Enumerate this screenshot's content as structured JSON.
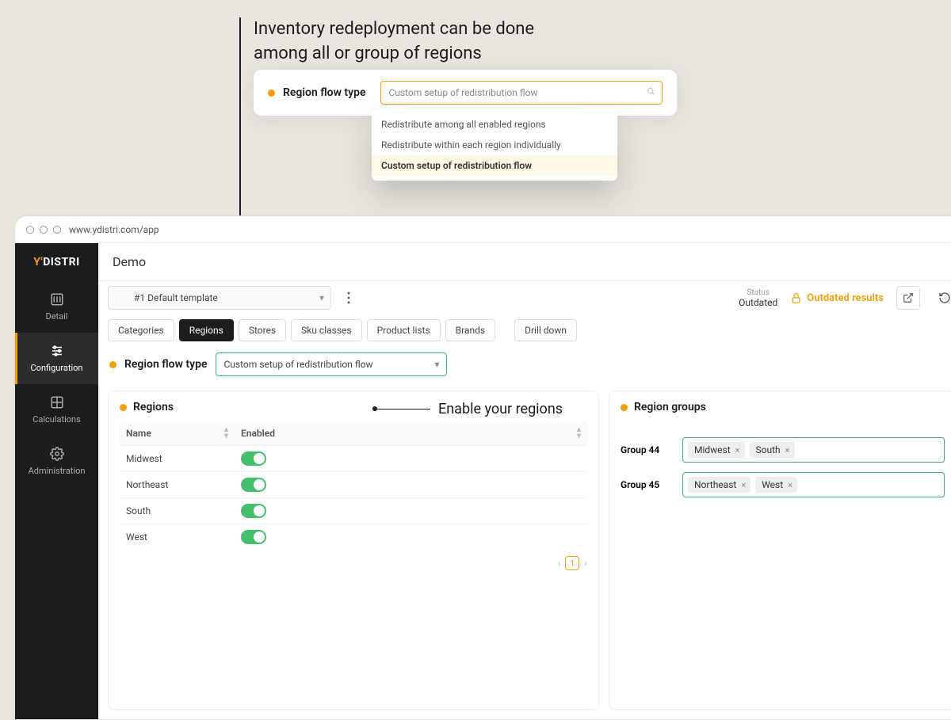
{
  "callout": {
    "line1": "Inventory redeployment can be done",
    "line2": "among all or group of regions"
  },
  "float": {
    "label": "Region flow type",
    "placeholder": "Custom setup of redistribution flow",
    "options": [
      "Redistribute among all enabled regions",
      "Redistribute within each region individually",
      "Custom setup of redistribution flow"
    ]
  },
  "browser": {
    "url": "www.ydistri.com/app"
  },
  "brand": {
    "prefix": "Y'",
    "rest": "DISTRI"
  },
  "sidebar": {
    "items": [
      {
        "label": "Detail"
      },
      {
        "label": "Configuration"
      },
      {
        "label": "Calculations"
      },
      {
        "label": "Administration"
      }
    ]
  },
  "title": "Demo",
  "template": {
    "label": "#1  Default template"
  },
  "status": {
    "label": "Status",
    "value": "Outdated"
  },
  "outdated_pill": "Outdated results",
  "tabs": [
    "Categories",
    "Regions",
    "Stores",
    "Sku classes",
    "Product lists",
    "Brands",
    "Drill down"
  ],
  "flow": {
    "label": "Region flow type",
    "value": "Custom setup of redistribution flow"
  },
  "regions_panel": {
    "title": "Regions",
    "enable_callout": "Enable your regions",
    "col_name": "Name",
    "col_enabled": "Enabled",
    "rows": [
      {
        "name": "Midwest"
      },
      {
        "name": "Northeast"
      },
      {
        "name": "South"
      },
      {
        "name": "West"
      }
    ],
    "page": "1"
  },
  "groups_panel": {
    "title": "Region groups",
    "groups": [
      {
        "label": "Group 44",
        "tags": [
          "Midwest",
          "South"
        ]
      },
      {
        "label": "Group 45",
        "tags": [
          "Northeast",
          "West"
        ]
      }
    ]
  }
}
